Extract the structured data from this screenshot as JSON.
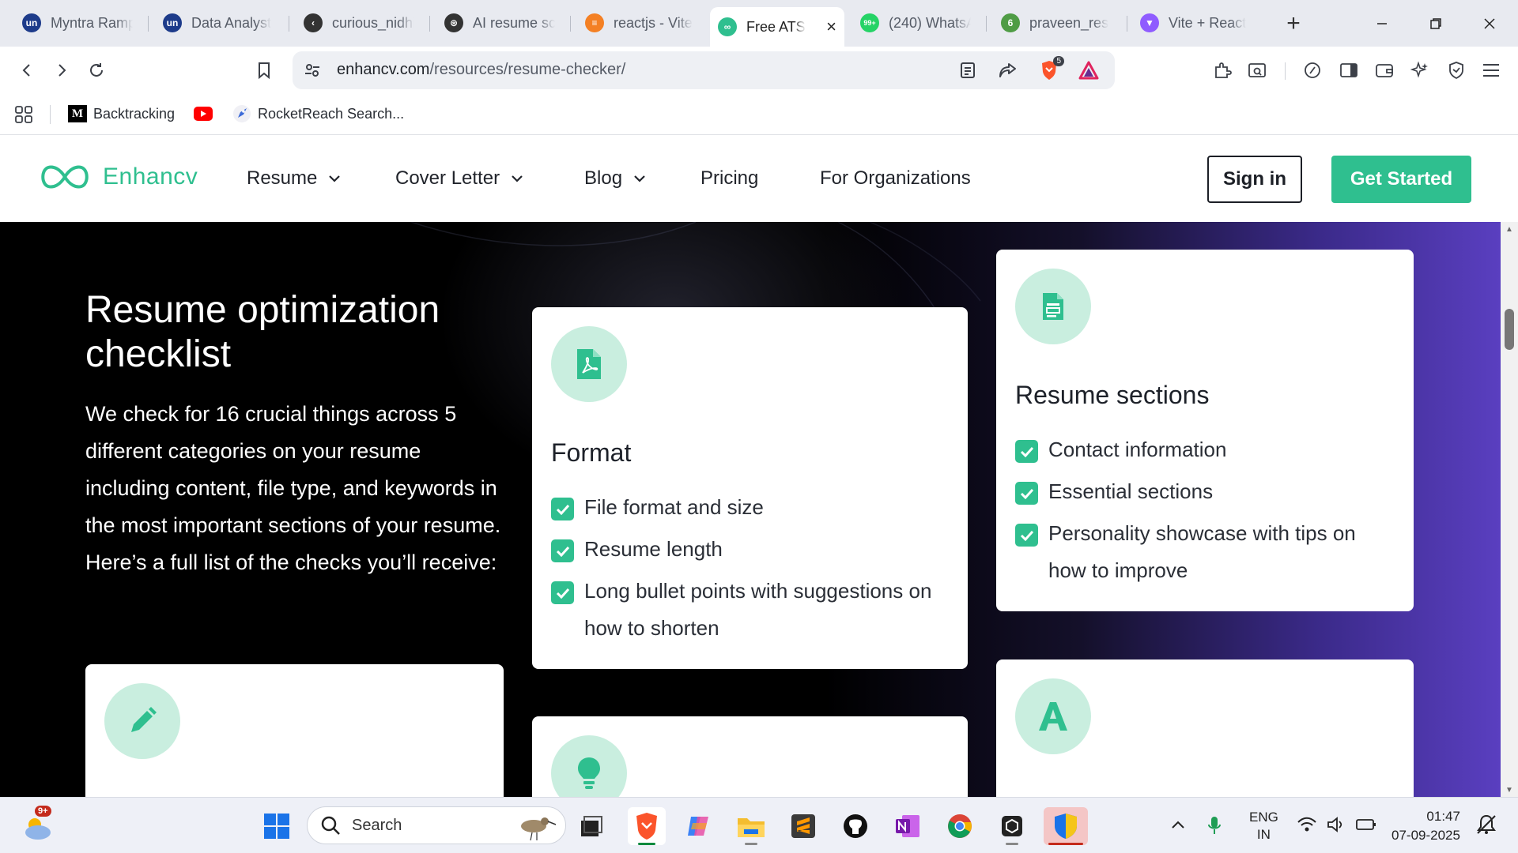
{
  "browser": {
    "tabs": [
      {
        "title": "Myntra Ramp",
        "icon": "unstop-icon",
        "color": "#1d3b8a",
        "glyph": "un"
      },
      {
        "title": "Data Analyst",
        "icon": "unstop-icon",
        "color": "#1d3b8a",
        "glyph": "un"
      },
      {
        "title": "curious_nidhi",
        "icon": "leetcode-icon",
        "color": "#333333",
        "glyph": "‹"
      },
      {
        "title": "AI resume sc",
        "icon": "openai-icon",
        "color": "#333333",
        "glyph": "⊛"
      },
      {
        "title": "reactjs - Vite",
        "icon": "stackoverflow-icon",
        "color": "#f48024",
        "glyph": "≡"
      },
      {
        "title": "Free ATS",
        "icon": "enhancv-icon",
        "color": "#2fbf8f",
        "glyph": "∞",
        "active": true
      },
      {
        "title": "(240) WhatsA",
        "icon": "whatsapp-icon",
        "color": "#25d366",
        "glyph": "99+"
      },
      {
        "title": "praveen_res",
        "icon": "overleaf-icon",
        "color": "#4f9c45",
        "glyph": "6"
      },
      {
        "title": "Vite + React",
        "icon": "vite-icon",
        "color": "#8f5cff",
        "glyph": "▼"
      }
    ],
    "url_host": "enhancv.com",
    "url_path": "/resources/resume-checker/",
    "brave_badge": "5",
    "bookmarks": [
      {
        "label": "Backtracking",
        "icon": "medium-icon"
      },
      {
        "label": "",
        "icon": "youtube-icon"
      },
      {
        "label": "RocketReach Search...",
        "icon": "rocketreach-icon"
      }
    ]
  },
  "site": {
    "logo_text": "Enhancv",
    "nav": [
      {
        "label": "Resume",
        "dropdown": true
      },
      {
        "label": "Cover Letter",
        "dropdown": true
      },
      {
        "label": "Blog",
        "dropdown": true
      },
      {
        "label": "Pricing",
        "dropdown": false
      },
      {
        "label": "For Organizations",
        "dropdown": false
      }
    ],
    "sign_in": "Sign in",
    "get_started": "Get Started"
  },
  "hero": {
    "title": "Resume optimization checklist",
    "text": "We check for 16 crucial things across 5 different categories on your resume including content, file type, and keywords in the most important sections of your resume. Here’s a full list of the checks you’ll receive:"
  },
  "cards": {
    "format": {
      "title": "Format",
      "items": [
        "File format and size",
        "Resume length",
        "Long bullet points with suggestions on how to shorten"
      ]
    },
    "sections": {
      "title": "Resume sections",
      "items": [
        "Contact information",
        "Essential sections",
        "Personality showcase with tips on how to improve"
      ]
    }
  },
  "taskbar": {
    "weather_badge": "9+",
    "search_placeholder": "Search",
    "language_line1": "ENG",
    "language_line2": "IN",
    "time": "01:47",
    "date": "07-09-2025"
  },
  "colors": {
    "accent": "#2fbf8f",
    "accent_light": "#c9eedf",
    "hero_purple": "#5a3fc0"
  }
}
